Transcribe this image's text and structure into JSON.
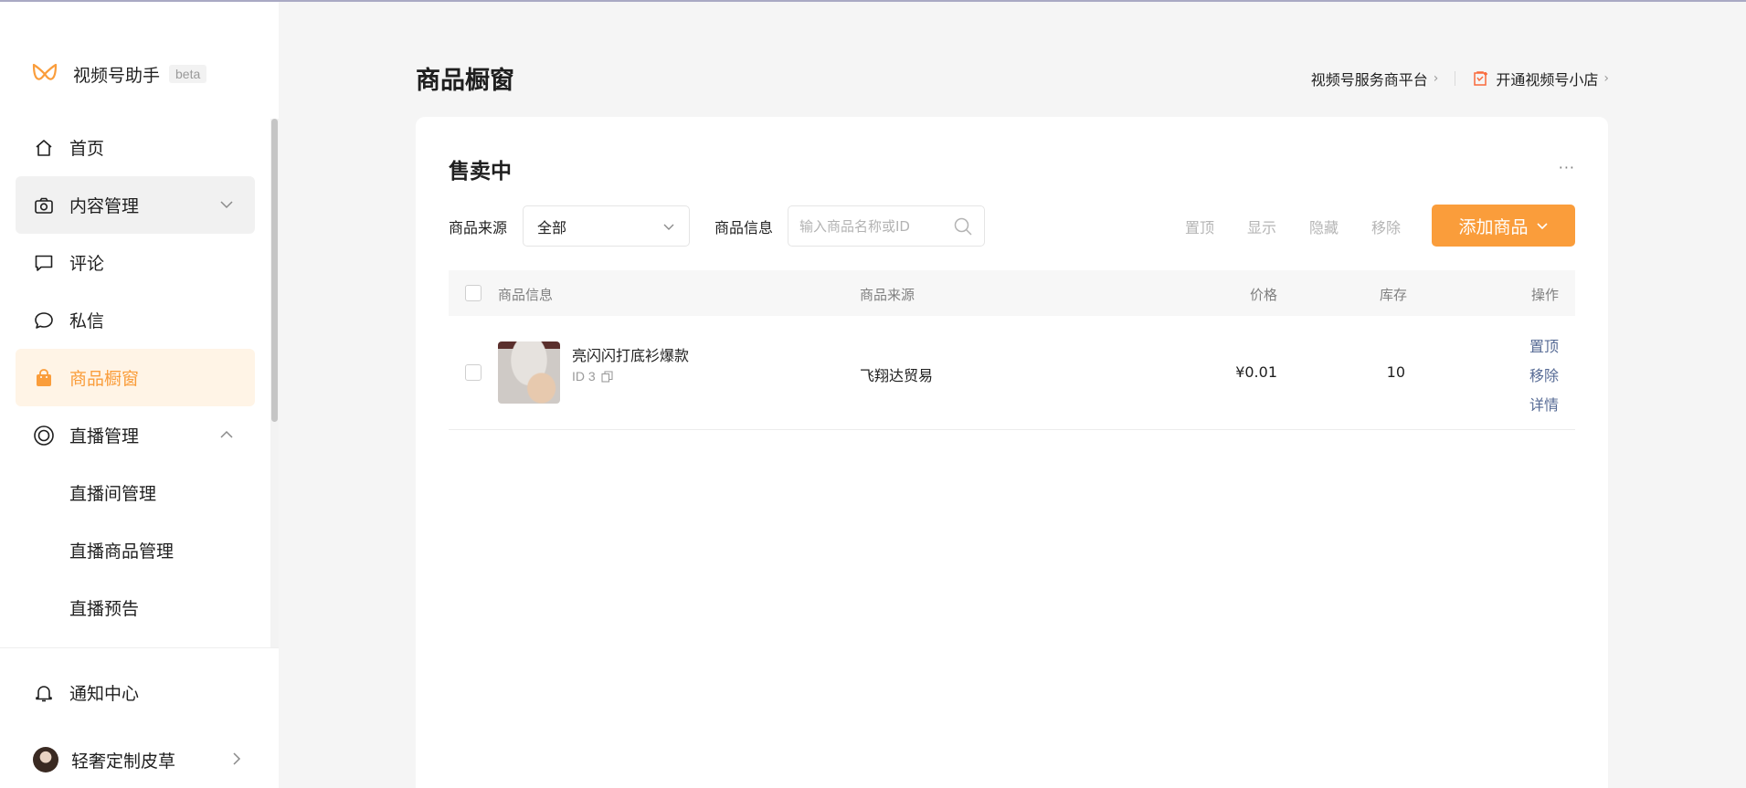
{
  "app": {
    "name": "视频号助手",
    "badge": "beta"
  },
  "sidebar": {
    "items": [
      {
        "label": "首页",
        "icon": "home-icon"
      },
      {
        "label": "内容管理",
        "icon": "camera-icon",
        "arrow": "chevron-down-icon"
      },
      {
        "label": "评论",
        "icon": "comment-icon"
      },
      {
        "label": "私信",
        "icon": "chat-bubble-icon"
      },
      {
        "label": "商品橱窗",
        "icon": "shopping-bag-icon",
        "active": true
      },
      {
        "label": "直播管理",
        "icon": "live-icon",
        "arrow": "chevron-up-icon"
      }
    ],
    "subitems": [
      {
        "label": "直播间管理"
      },
      {
        "label": "直播商品管理"
      },
      {
        "label": "直播预告"
      }
    ],
    "notifications_label": "通知中心",
    "user_name": "轻奢定制皮草"
  },
  "header": {
    "title": "商品橱窗",
    "link_service": "视频号服务商平台",
    "link_shop": "开通视频号小店"
  },
  "card": {
    "title": "售卖中",
    "more": "···",
    "filters": {
      "source_label": "商品来源",
      "source_value": "全部",
      "info_label": "商品信息",
      "search_placeholder": "输入商品名称或ID"
    },
    "bulk_actions": {
      "pin": "置顶",
      "show": "显示",
      "hide": "隐藏",
      "remove": "移除"
    },
    "add_button": "添加商品"
  },
  "table": {
    "columns": {
      "info": "商品信息",
      "source": "商品来源",
      "price": "价格",
      "stock": "库存",
      "actions": "操作"
    },
    "rows": [
      {
        "name": "亮闪闪打底衫爆款",
        "id": "ID 3",
        "source": "飞翔达贸易",
        "price": "¥0.01",
        "stock": "10",
        "actions": {
          "pin": "置顶",
          "remove": "移除",
          "detail": "详情"
        }
      }
    ]
  },
  "colors": {
    "accent": "#fa9d3b",
    "active_bg": "#fff4e6",
    "link": "#576b95",
    "page_bg": "#f5f5f5"
  }
}
